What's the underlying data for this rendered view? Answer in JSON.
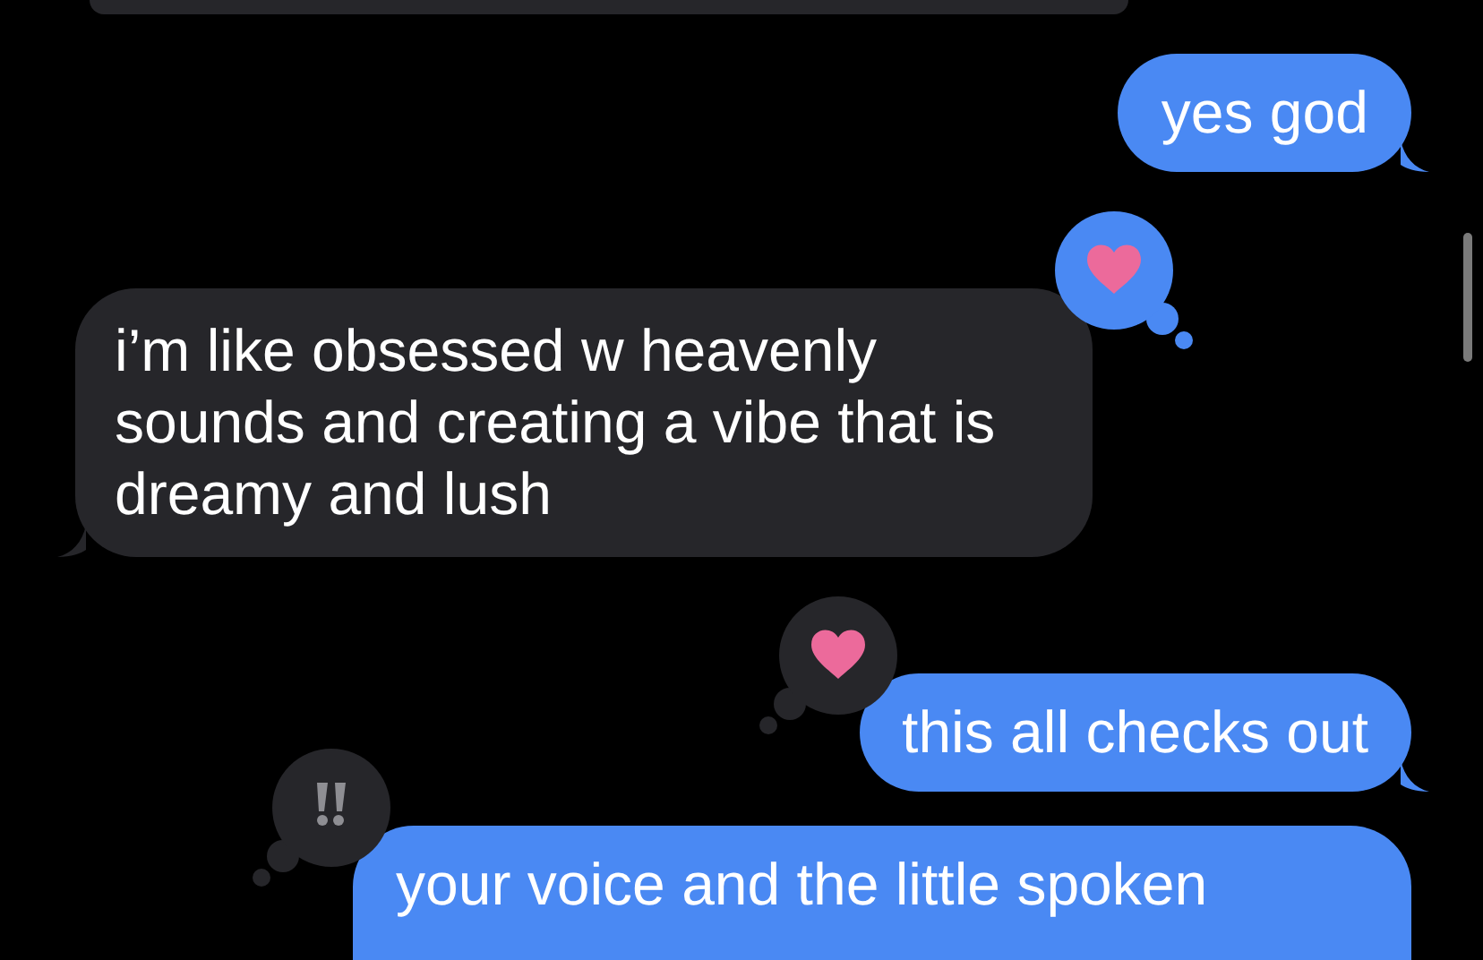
{
  "messages": [
    {
      "kind": "received"
    },
    {
      "kind": "sent",
      "text": "yes god"
    },
    {
      "kind": "received",
      "text": "i’m like obsessed w heavenly sounds and creating a vibe that is dreamy and lush",
      "reaction": {
        "kind": "heart",
        "mine": true
      }
    },
    {
      "kind": "sent",
      "text": "this all checks out",
      "reaction": {
        "kind": "heart",
        "mine": false
      }
    },
    {
      "kind": "sent",
      "text": "your voice and the little spoken",
      "cut": true,
      "reaction": {
        "kind": "exclaim",
        "mine": false
      }
    }
  ]
}
